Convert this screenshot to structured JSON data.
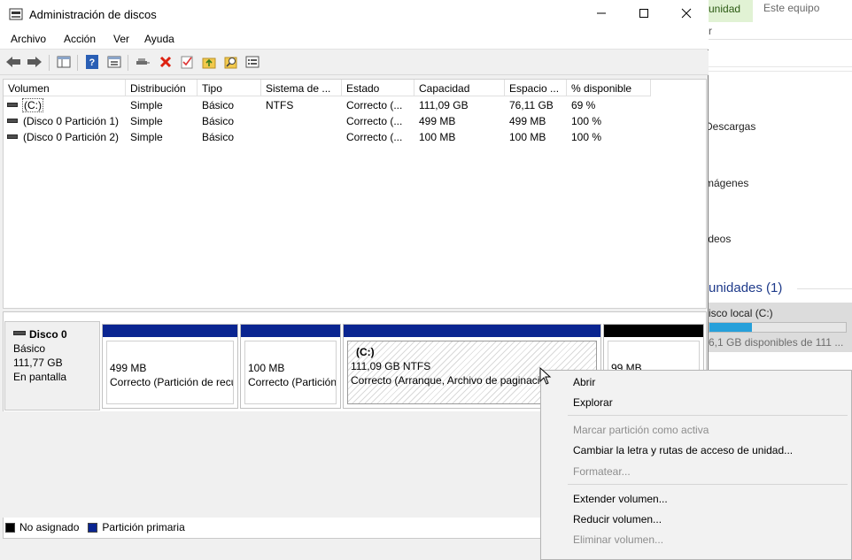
{
  "window": {
    "title": "Administración de discos"
  },
  "menu": {
    "items": [
      "Archivo",
      "Acción",
      "Ver",
      "Ayuda"
    ]
  },
  "toolbar": {
    "icons": [
      "back-arrow-icon",
      "forward-arrow-icon",
      "console-tree-icon",
      "help-icon",
      "properties-icon",
      "connect-icon",
      "delete-icon",
      "check-icon",
      "up-folder-icon",
      "search-icon",
      "list-icon"
    ]
  },
  "list": {
    "columns": [
      "Volumen",
      "Distribución",
      "Tipo",
      "Sistema de ...",
      "Estado",
      "Capacidad",
      "Espacio ...",
      "% disponible"
    ],
    "rows": [
      [
        "(C:)",
        "Simple",
        "Básico",
        "NTFS",
        "Correcto (...",
        "111,09 GB",
        "76,11 GB",
        "69 %"
      ],
      [
        "(Disco 0 Partición 1)",
        "Simple",
        "Básico",
        "",
        "Correcto (...",
        "499 MB",
        "499 MB",
        "100 %"
      ],
      [
        "(Disco 0 Partición 2)",
        "Simple",
        "Básico",
        "",
        "Correcto (...",
        "100 MB",
        "100 MB",
        "100 %"
      ]
    ]
  },
  "disk": {
    "name": "Disco 0",
    "type": "Básico",
    "size": "111,77 GB",
    "status": "En pantalla",
    "partitions": [
      {
        "size": "499 MB",
        "status": "Correcto (Partición de recuperación)"
      },
      {
        "size": "100 MB",
        "status": "Correcto (Partición de sistema EFI)"
      },
      {
        "label": "(C:)",
        "size": "111,09 GB NTFS",
        "status": "Correcto (Arranque, Archivo de paginación)"
      },
      {
        "size": "99 MB",
        "status": ""
      }
    ]
  },
  "legend": {
    "unallocated": "No asignado",
    "primary": "Partición primaria"
  },
  "context_menu": {
    "items": [
      {
        "label": "Abrir",
        "enabled": true
      },
      {
        "label": "Explorar",
        "enabled": true
      },
      {
        "label": "Marcar partición como activa",
        "enabled": false
      },
      {
        "label": "Cambiar la letra y rutas de acceso de unidad...",
        "enabled": true
      },
      {
        "label": "Formatear...",
        "enabled": false
      },
      {
        "label": "Extender volumen...",
        "enabled": true
      },
      {
        "label": "Reducir volumen...",
        "enabled": true
      },
      {
        "label": "Eliminar volumen...",
        "enabled": false
      }
    ]
  },
  "background_explorer": {
    "tab_active": "unidad",
    "tab": "Este equipo",
    "ribbon_text": "r",
    "folders": [
      "Descargas",
      "mágenes",
      "ídeos"
    ],
    "section": "unidades (1)",
    "drive_name": "isco local (C:)",
    "drive_free": "6,1 GB disponibles de 111 ...",
    "drive_used_fraction": 0.31
  },
  "colors": {
    "primary_partition": "#0a2591",
    "unallocated": "#000000",
    "drive_bar": "#26a0da"
  }
}
